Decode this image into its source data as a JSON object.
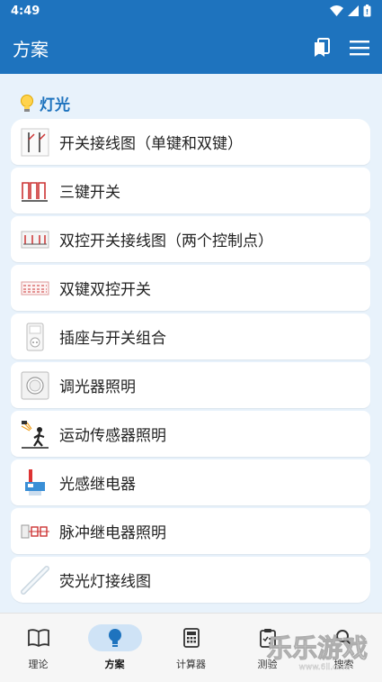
{
  "status": {
    "time": "4:49"
  },
  "app_bar": {
    "title": "方案"
  },
  "section": {
    "title": "灯光"
  },
  "items": [
    {
      "label": "开关接线图（单键和双键）",
      "icon": "single-double-switch-diagram"
    },
    {
      "label": "三键开关",
      "icon": "three-gang-switch-diagram"
    },
    {
      "label": "双控开关接线图（两个控制点）",
      "icon": "two-way-switch-diagram"
    },
    {
      "label": "双键双控开关",
      "icon": "double-two-way-switch-diagram"
    },
    {
      "label": "插座与开关组合",
      "icon": "socket-switch-combo"
    },
    {
      "label": "调光器照明",
      "icon": "dimmer-knob"
    },
    {
      "label": "运动传感器照明",
      "icon": "motion-sensor"
    },
    {
      "label": "光感继电器",
      "icon": "photo-relay"
    },
    {
      "label": "脉冲继电器照明",
      "icon": "pulse-relay"
    },
    {
      "label": "荧光灯接线图",
      "icon": "fluorescent-tube"
    }
  ],
  "bottom_nav": [
    {
      "label": "理论",
      "icon": "book-icon",
      "active": false
    },
    {
      "label": "方案",
      "icon": "lightbulb-icon",
      "active": true
    },
    {
      "label": "计算器",
      "icon": "calculator-icon",
      "active": false
    },
    {
      "label": "测验",
      "icon": "clipboard-icon",
      "active": false
    },
    {
      "label": "搜索",
      "icon": "search-icon",
      "active": false
    }
  ],
  "watermark": {
    "text": "乐乐游戏",
    "subtext": "www.6ll.com"
  },
  "colors": {
    "primary": "#1e73be",
    "background": "#e8f2fb",
    "active_pill": "#cfe3f6"
  }
}
